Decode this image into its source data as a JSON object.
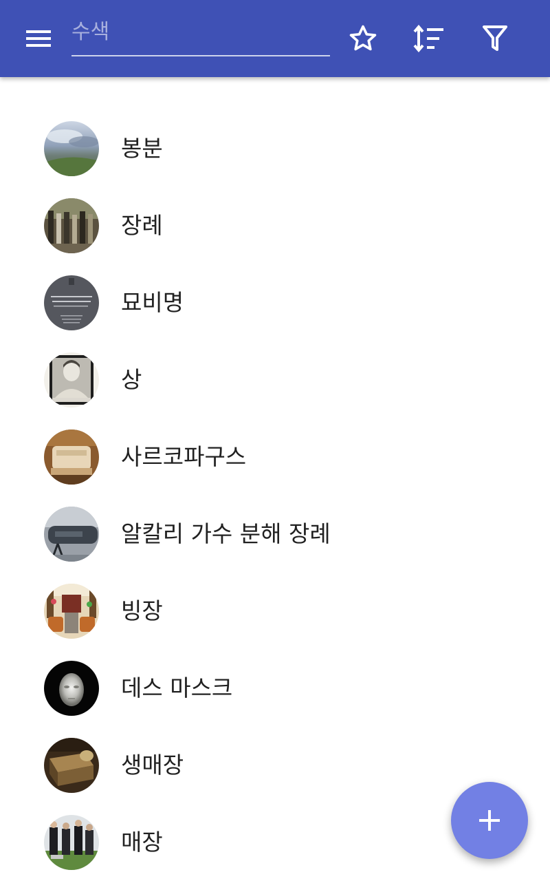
{
  "toolbar": {
    "search_placeholder": "수색",
    "search_value": "",
    "icons": {
      "menu": "hamburger-menu-icon",
      "favorite": "star-outline-icon",
      "sort": "sort-icon",
      "filter": "filter-icon"
    }
  },
  "colors": {
    "appbar": "#3f51b5",
    "fab": "#7280e4",
    "text": "#212121"
  },
  "list": {
    "items": [
      {
        "label": "봉분",
        "thumb": "mound-photo"
      },
      {
        "label": "장례",
        "thumb": "funeral-procession-photo"
      },
      {
        "label": "묘비명",
        "thumb": "epitaph-plaque-photo"
      },
      {
        "label": "상",
        "thumb": "portrait-stamp-photo"
      },
      {
        "label": "사르코파구스",
        "thumb": "sarcophagus-photo"
      },
      {
        "label": "알칼리 가수 분해 장례",
        "thumb": "alkaline-hydrolysis-machine-photo"
      },
      {
        "label": "빙장",
        "thumb": "ice-burial-room-photo"
      },
      {
        "label": "데스 마스크",
        "thumb": "death-mask-photo"
      },
      {
        "label": "생매장",
        "thumb": "coffin-photo"
      },
      {
        "label": "매장",
        "thumb": "burial-ceremony-photo"
      }
    ]
  },
  "fab": {
    "icon": "plus-icon"
  }
}
